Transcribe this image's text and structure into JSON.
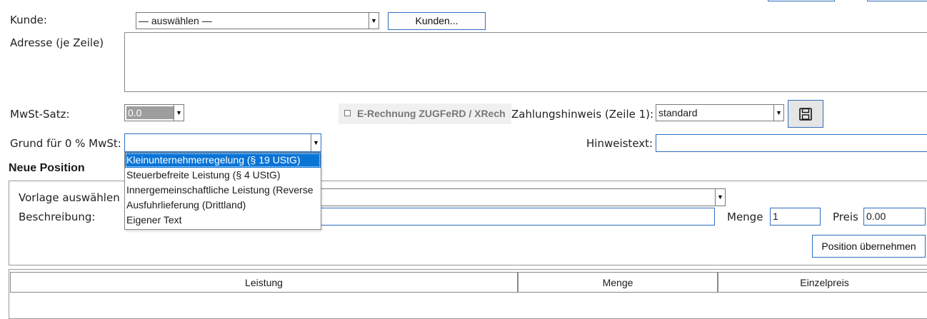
{
  "customer": {
    "label": "Kunde:",
    "select_value": "— auswählen —",
    "button_label": "Kunden..."
  },
  "address": {
    "label": "Adresse (je Zeile)"
  },
  "vat": {
    "label": "MwSt-Satz:",
    "value": "0.0"
  },
  "erechnung": {
    "checkbox_label": "E-Rechnung ZUGFeRD / XRech"
  },
  "payment": {
    "label": "Zahlungshinweis (Zeile 1):",
    "value": "standard"
  },
  "vat_reason": {
    "label": "Grund für 0 % MwSt:",
    "value": "",
    "options": [
      "Kleinunternehmerregelung (§ 19 UStG)",
      "Steuerbefreite Leistung (§ 4 UStG)",
      "Innergemeinschaftliche Leistung (Reverse",
      "Ausfuhrlieferung (Drittland)",
      "Eigener Text"
    ]
  },
  "note": {
    "label": "Hinweistext:",
    "value": ""
  },
  "new_position": {
    "heading": "Neue Position",
    "template_label": "Vorlage auswählen",
    "description_label": "Beschreibung:",
    "quantity_label": "Menge",
    "quantity_value": "1",
    "price_label": "Preis",
    "price_value": "0.00",
    "apply_button": "Position übernehmen"
  },
  "table": {
    "columns": [
      "Leistung",
      "Menge",
      "Einzelpreis"
    ]
  },
  "icons": {
    "save": "floppy-disk-icon"
  }
}
